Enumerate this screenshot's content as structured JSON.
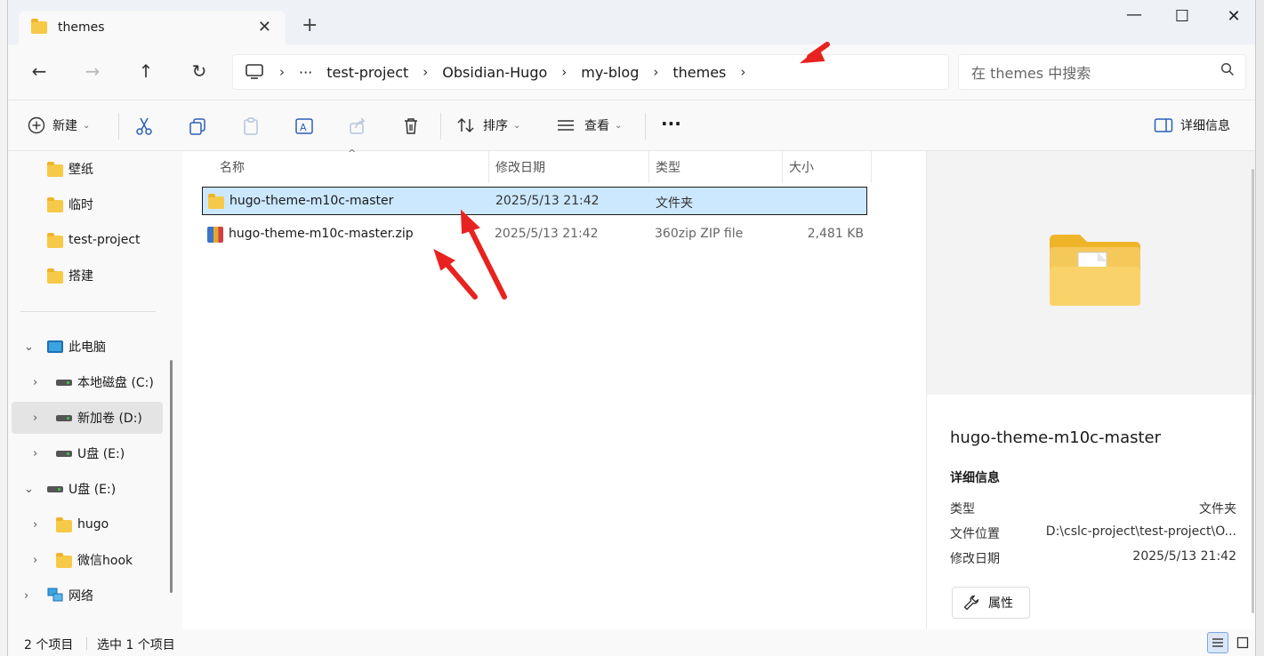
{
  "window": {
    "tab_title": "themes",
    "tab_close": "✕",
    "new_tab": "+",
    "minimize": "—",
    "maximize": "☐",
    "close": "✕"
  },
  "nav": {
    "back": "←",
    "forward": "→",
    "up": "↑",
    "refresh": "↻",
    "breadcrumb": [
      "test-project",
      "Obsidian-Hugo",
      "my-blog",
      "themes"
    ],
    "more": "···",
    "search_placeholder": "在 themes 中搜索"
  },
  "toolbar": {
    "new_label": "新建",
    "sort_label": "排序",
    "view_label": "查看",
    "more_label": "···",
    "details_label": "详细信息"
  },
  "sidebar": {
    "quick": [
      "壁纸",
      "临时",
      "test-project",
      "搭建"
    ],
    "this_pc": "此电脑",
    "drives": [
      "本地磁盘 (C:)",
      "新加卷 (D:)",
      "U盘 (E:)"
    ],
    "usb_root": "U盘 (E:)",
    "usb_children": [
      "hugo",
      "微信hook"
    ],
    "network": "网络"
  },
  "files": {
    "columns": {
      "name": "名称",
      "date": "修改日期",
      "type": "类型",
      "size": "大小"
    },
    "rows": [
      {
        "name": "hugo-theme-m10c-master",
        "date": "2025/5/13 21:42",
        "type": "文件夹",
        "size": "",
        "icon": "folder-icon",
        "selected": true
      },
      {
        "name": "hugo-theme-m10c-master.zip",
        "date": "2025/5/13 21:42",
        "type": "360zip ZIP file",
        "size": "2,481 KB",
        "icon": "zip-icon",
        "selected": false
      }
    ]
  },
  "details": {
    "title": "hugo-theme-m10c-master",
    "section": "详细信息",
    "type_key": "类型",
    "type_val": "文件夹",
    "loc_key": "文件位置",
    "loc_val": "D:\\cslc-project\\test-project\\O...",
    "date_key": "修改日期",
    "date_val": "2025/5/13 21:42",
    "properties_btn": "属性"
  },
  "status": {
    "count": "2 个项目",
    "selected": "选中 1 个项目"
  },
  "colors": {
    "accent": "#2a5fb8",
    "selection": "#cce8ff",
    "folder": "#f7c948",
    "annotation": "#e8231f"
  }
}
